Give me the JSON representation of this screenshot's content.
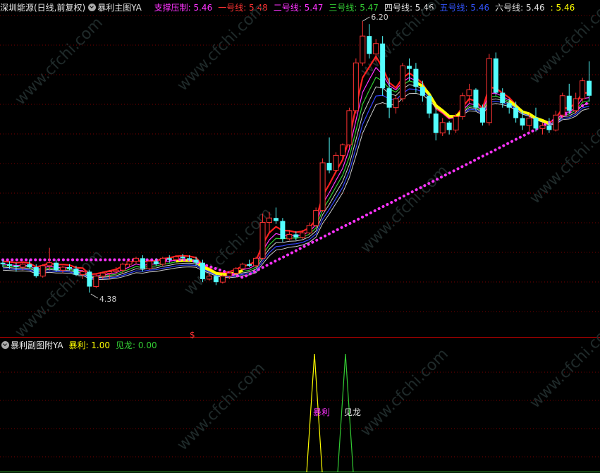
{
  "main_header": {
    "title": "深圳能源(日线,前复权)",
    "indicator_name": "暴利主图YA",
    "items": [
      {
        "label": "支撑压制:",
        "value": "5.46",
        "color": "#ff33ff"
      },
      {
        "label": "一号线:",
        "value": "5.48",
        "color": "#ff3333"
      },
      {
        "label": "二号线:",
        "value": "5.47",
        "color": "#ff33ff"
      },
      {
        "label": "三号线:",
        "value": "5.47",
        "color": "#33cc33"
      },
      {
        "label": "四号线:",
        "value": "5.46",
        "color": "#e0e0e0"
      },
      {
        "label": "五号线:",
        "value": "5.46",
        "color": "#3355ff"
      },
      {
        "label": "六号线:",
        "value": "5.46",
        "color": "#e0e0e0"
      },
      {
        "label": ":",
        "value": "5.46",
        "color": "#ffff00"
      }
    ]
  },
  "sub_header": {
    "indicator_name": "暴利副图附YA",
    "items": [
      {
        "label": "暴利:",
        "value": "1.00",
        "color": "#ffff00"
      },
      {
        "label": "见龙:",
        "value": "0.00",
        "color": "#33cc33"
      }
    ]
  },
  "annotations": {
    "high_label": "6.20",
    "low_label": "4.38",
    "dollar_marker": "$",
    "signal_baoli": "暴利",
    "signal_jianlong": "见龙"
  },
  "watermark": "www.cfchi.com",
  "colors": {
    "background": "#000000",
    "up_candle": "#ff3333",
    "down_candle": "#54ffff",
    "grid": "#7a0000",
    "support_dots": "#ff33ff",
    "yellow_band": "#ffff00",
    "line1": "#ff2020",
    "line2": "#ff33ff",
    "line3": "#33cc33",
    "line4": "#cccccc",
    "line5": "#3344ff",
    "line6": "#cccccc"
  },
  "chart_data": {
    "type": "candlestick",
    "high": 6.2,
    "low": 4.38,
    "ohlc": [
      [
        4.58,
        4.6,
        4.55,
        4.57
      ],
      [
        4.57,
        4.59,
        4.54,
        4.56
      ],
      [
        4.56,
        4.58,
        4.52,
        4.55
      ],
      [
        4.55,
        4.58,
        4.53,
        4.57
      ],
      [
        4.57,
        4.6,
        4.54,
        4.55
      ],
      [
        4.55,
        4.57,
        4.48,
        4.49
      ],
      [
        4.49,
        4.57,
        4.48,
        4.56
      ],
      [
        4.56,
        4.68,
        4.53,
        4.58
      ],
      [
        4.58,
        4.6,
        4.52,
        4.53
      ],
      [
        4.53,
        4.56,
        4.51,
        4.55
      ],
      [
        4.55,
        4.57,
        4.53,
        4.54
      ],
      [
        4.54,
        4.56,
        4.49,
        4.5
      ],
      [
        4.5,
        4.53,
        4.47,
        4.52
      ],
      [
        4.52,
        4.53,
        4.38,
        4.42
      ],
      [
        4.42,
        4.5,
        4.41,
        4.49
      ],
      [
        4.49,
        4.52,
        4.47,
        4.51
      ],
      [
        4.51,
        4.53,
        4.47,
        4.52
      ],
      [
        4.52,
        4.55,
        4.5,
        4.53
      ],
      [
        4.53,
        4.58,
        4.51,
        4.57
      ],
      [
        4.57,
        4.6,
        4.55,
        4.59
      ],
      [
        4.59,
        4.62,
        4.57,
        4.61
      ],
      [
        4.61,
        4.63,
        4.52,
        4.54
      ],
      [
        4.54,
        4.6,
        4.53,
        4.59
      ],
      [
        4.59,
        4.61,
        4.56,
        4.57
      ],
      [
        4.57,
        4.62,
        4.56,
        4.61
      ],
      [
        4.61,
        4.63,
        4.58,
        4.6
      ],
      [
        4.6,
        4.63,
        4.59,
        4.62
      ],
      [
        4.62,
        4.64,
        4.6,
        4.61
      ],
      [
        4.61,
        4.63,
        4.59,
        4.6
      ],
      [
        4.6,
        4.62,
        4.56,
        4.58
      ],
      [
        4.58,
        4.6,
        4.45,
        4.47
      ],
      [
        4.47,
        4.51,
        4.46,
        4.49
      ],
      [
        4.49,
        4.5,
        4.43,
        4.45
      ],
      [
        4.45,
        4.5,
        4.44,
        4.49
      ],
      [
        4.49,
        4.52,
        4.47,
        4.51
      ],
      [
        4.51,
        4.55,
        4.5,
        4.54
      ],
      [
        4.54,
        4.58,
        4.53,
        4.57
      ],
      [
        4.57,
        4.6,
        4.55,
        4.56
      ],
      [
        4.56,
        4.62,
        4.55,
        4.61
      ],
      [
        4.61,
        4.91,
        4.6,
        4.85
      ],
      [
        4.85,
        4.92,
        4.78,
        4.88
      ],
      [
        4.88,
        4.95,
        4.84,
        4.86
      ],
      [
        4.86,
        4.88,
        4.72,
        4.74
      ],
      [
        4.74,
        4.8,
        4.73,
        4.77
      ],
      [
        4.77,
        4.79,
        4.73,
        4.75
      ],
      [
        4.75,
        4.8,
        4.74,
        4.78
      ],
      [
        4.78,
        4.85,
        4.77,
        4.83
      ],
      [
        4.83,
        4.95,
        4.82,
        4.93
      ],
      [
        4.93,
        5.28,
        4.92,
        5.25
      ],
      [
        5.25,
        5.42,
        5.18,
        5.2
      ],
      [
        5.2,
        5.32,
        5.18,
        5.3
      ],
      [
        5.3,
        5.38,
        5.27,
        5.37
      ],
      [
        5.37,
        5.62,
        5.35,
        5.6
      ],
      [
        5.6,
        5.95,
        5.58,
        5.92
      ],
      [
        5.92,
        6.2,
        5.9,
        6.1
      ],
      [
        6.1,
        6.18,
        5.95,
        5.98
      ],
      [
        5.98,
        6.08,
        5.93,
        6.05
      ],
      [
        6.05,
        6.1,
        5.7,
        5.75
      ],
      [
        5.75,
        5.82,
        5.55,
        5.62
      ],
      [
        5.62,
        5.7,
        5.58,
        5.68
      ],
      [
        5.68,
        5.92,
        5.66,
        5.9
      ],
      [
        5.9,
        5.95,
        5.8,
        5.88
      ],
      [
        5.88,
        5.92,
        5.72,
        5.76
      ],
      [
        5.76,
        5.8,
        5.66,
        5.7
      ],
      [
        5.7,
        5.72,
        5.55,
        5.58
      ],
      [
        5.58,
        5.62,
        5.4,
        5.45
      ],
      [
        5.45,
        5.55,
        5.43,
        5.52
      ],
      [
        5.52,
        5.53,
        5.44,
        5.47
      ],
      [
        5.47,
        5.58,
        5.45,
        5.56
      ],
      [
        5.56,
        5.72,
        5.54,
        5.7
      ],
      [
        5.7,
        5.78,
        5.65,
        5.74
      ],
      [
        5.74,
        5.75,
        5.6,
        5.62
      ],
      [
        5.62,
        5.64,
        5.5,
        5.52
      ],
      [
        5.52,
        5.98,
        5.5,
        5.95
      ],
      [
        5.95,
        5.99,
        5.7,
        5.72
      ],
      [
        5.72,
        5.75,
        5.62,
        5.65
      ],
      [
        5.65,
        5.68,
        5.58,
        5.62
      ],
      [
        5.62,
        5.66,
        5.52,
        5.55
      ],
      [
        5.55,
        5.6,
        5.47,
        5.5
      ],
      [
        5.5,
        5.58,
        5.46,
        5.55
      ],
      [
        5.55,
        5.62,
        5.46,
        5.48
      ],
      [
        5.48,
        5.52,
        5.44,
        5.5
      ],
      [
        5.5,
        5.55,
        5.45,
        5.47
      ],
      [
        5.47,
        5.6,
        5.46,
        5.57
      ],
      [
        5.57,
        5.72,
        5.55,
        5.7
      ],
      [
        5.7,
        5.78,
        5.58,
        5.6
      ],
      [
        5.6,
        5.72,
        5.58,
        5.68
      ],
      [
        5.68,
        5.82,
        5.66,
        5.8
      ],
      [
        5.8,
        5.93,
        5.66,
        5.7
      ]
    ],
    "sub_signals": [
      {
        "name": "暴利",
        "bar_index": 46,
        "value": 1.0
      },
      {
        "name": "见龙",
        "bar_index": 50,
        "value": 1.0
      }
    ]
  }
}
